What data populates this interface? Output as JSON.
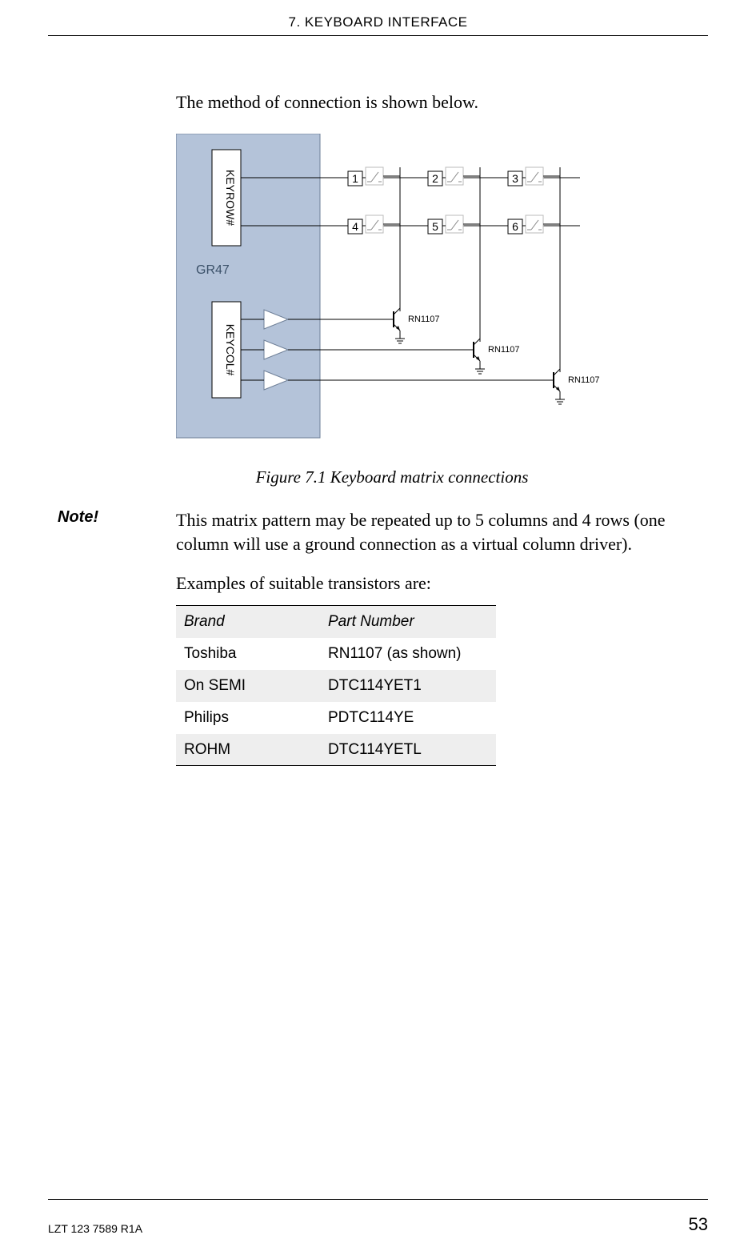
{
  "header": {
    "chapter_title": "7. KEYBOARD INTERFACE"
  },
  "body": {
    "intro": "The method of connection is shown below.",
    "caption": "Figure 7.1  Keyboard matrix connections",
    "note_label": "Note!",
    "note_text": "This matrix pattern may be repeated up to 5 columns and 4 rows (one column will use a ground connection as a virtual column driver).",
    "examples_intro": "Examples of suitable transistors are:"
  },
  "figure": {
    "device_label": "GR47",
    "row_label": "KEYROW#",
    "col_label": "KEYCOL#",
    "keys": [
      "1",
      "2",
      "3",
      "4",
      "5",
      "6"
    ],
    "transistor_label": "RN1107"
  },
  "table": {
    "headers": [
      "Brand",
      "Part Number"
    ],
    "rows": [
      {
        "brand": "Toshiba",
        "part": "RN1107 (as shown)"
      },
      {
        "brand": "On SEMI",
        "part": "DTC114YET1"
      },
      {
        "brand": "Philips",
        "part": "PDTC114YE"
      },
      {
        "brand": "ROHM",
        "part": "DTC114YETL"
      }
    ]
  },
  "footer": {
    "doc_id": "LZT 123 7589 R1A",
    "page_number": "53"
  }
}
